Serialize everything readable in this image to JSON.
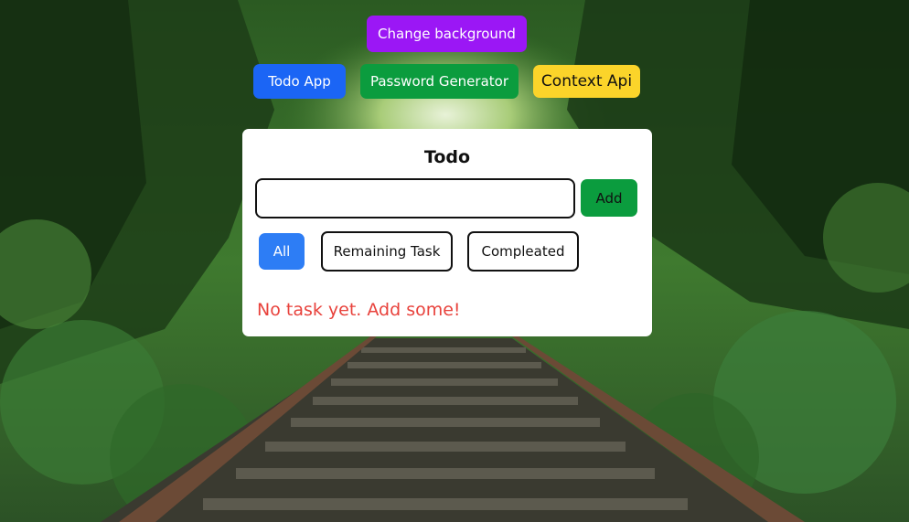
{
  "nav": {
    "change_background": "Change background",
    "todo_app": "Todo App",
    "password_generator": "Password Generator",
    "context_api": "Context Api"
  },
  "todo": {
    "title": "Todo",
    "input_value": "",
    "add_label": "Add",
    "filters": {
      "all": "All",
      "remaining": "Remaining Task",
      "completed": "Compleated"
    },
    "empty_message": "No task yet. Add some!"
  },
  "colors": {
    "change_background": "#9b17f5",
    "todo_app": "#1b65f5",
    "password_generator": "#0b9c3e",
    "context_api": "#fbd42a",
    "add": "#0b9c3e",
    "filter_active": "#2d7df5",
    "empty_message": "#e8423c"
  },
  "background": {
    "scene": "forest-railway-track"
  }
}
